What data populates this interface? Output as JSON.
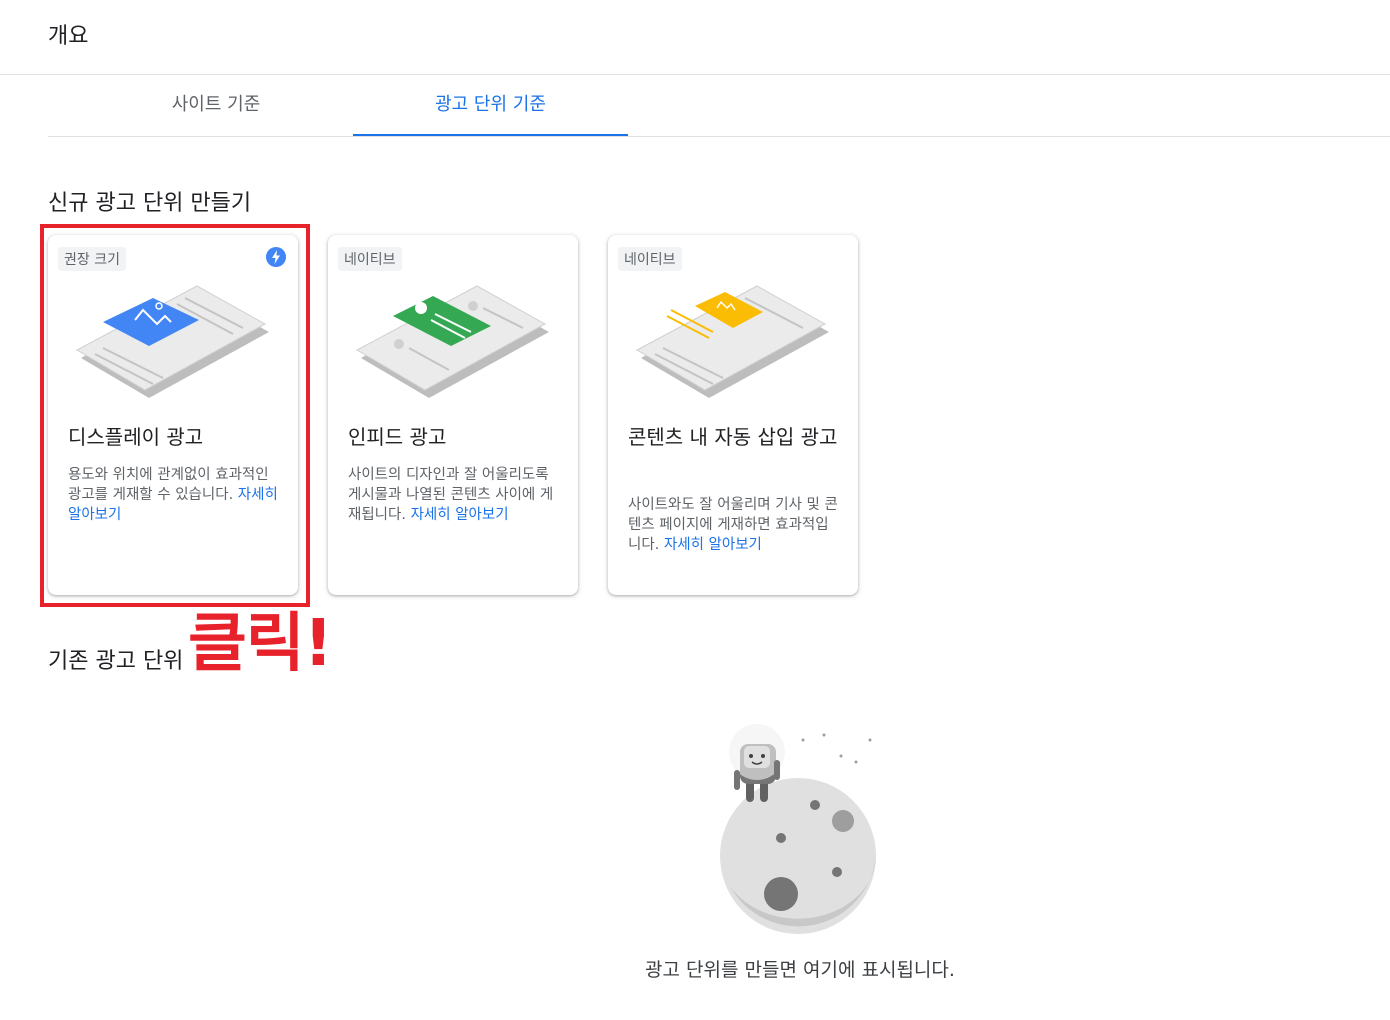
{
  "page": {
    "title": "개요"
  },
  "tabs": [
    {
      "label": "사이트 기준",
      "active": false
    },
    {
      "label": "광고 단위 기준",
      "active": true
    }
  ],
  "new_section": {
    "title": "신규 광고 단위 만들기"
  },
  "cards": [
    {
      "chip": "권장 크기",
      "title": "디스플레이 광고",
      "desc": "용도와 위치에 관계없이 효과적인 광고를 게재할 수 있습니다.",
      "link": "자세히 알아보기",
      "accent": "#4285f4",
      "has_bolt_icon": true
    },
    {
      "chip": "네이티브",
      "title": "인피드 광고",
      "desc": "사이트의 디자인과 잘 어울리도록 게시물과 나열된 콘텐츠 사이에 게재됩니다.",
      "link": "자세히 알아보기",
      "accent": "#34a853"
    },
    {
      "chip": "네이티브",
      "title": "콘텐츠 내 자동 삽입 광고",
      "desc": "사이트와도 잘 어울리며 기사 및 콘텐츠 페이지에 게재하면 효과적입니다.",
      "link": "자세히 알아보기",
      "accent": "#fbbc04"
    }
  ],
  "annotation": {
    "text": "클릭!",
    "color": "#e8222a"
  },
  "existing_section": {
    "title": "기존 광고 단위"
  },
  "empty_state": {
    "text": "광고 단위를 만들면 여기에 표시됩니다."
  },
  "colors": {
    "primary": "#1a73e8",
    "text": "#202124",
    "secondary_text": "#5f6368"
  }
}
